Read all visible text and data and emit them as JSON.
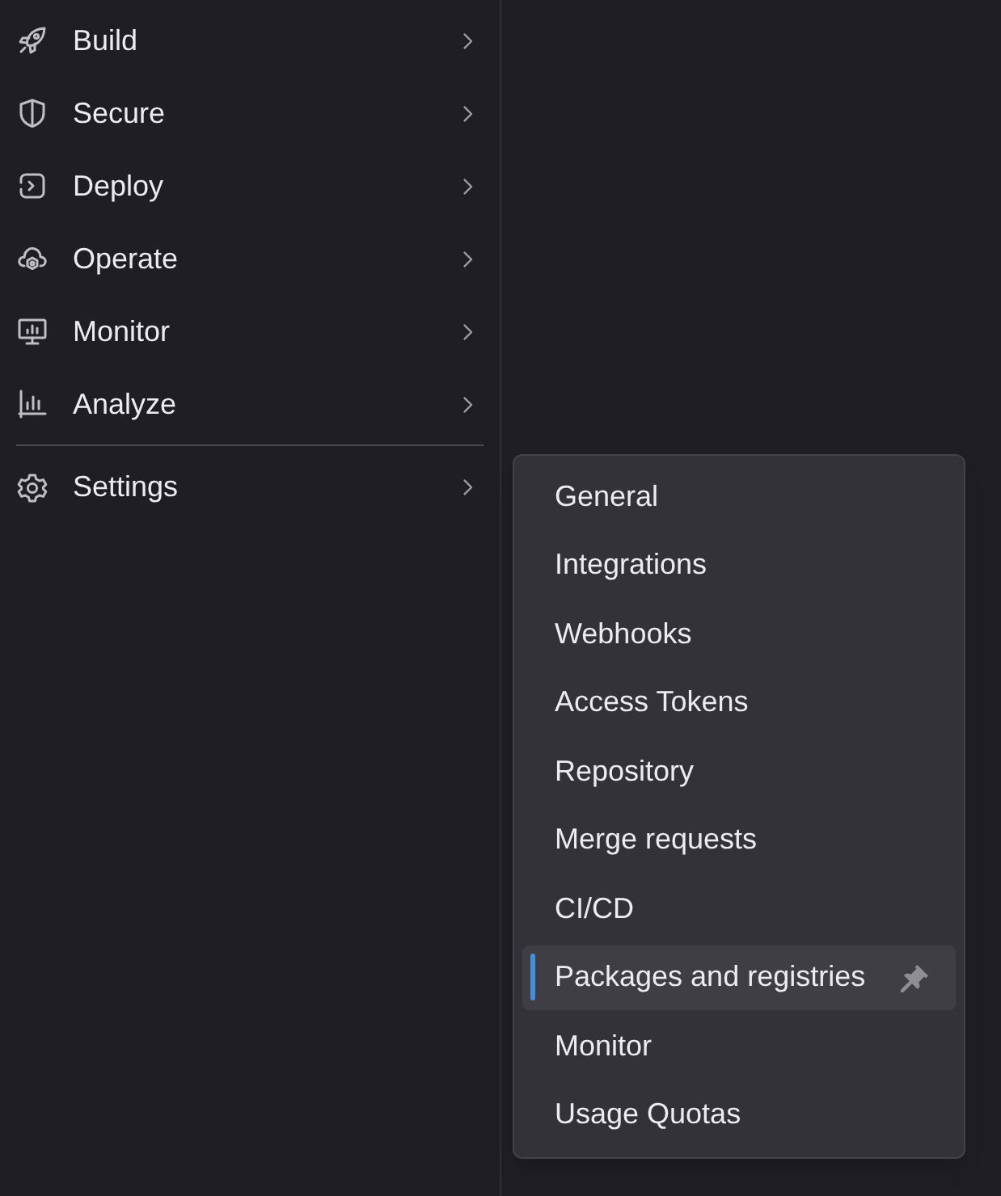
{
  "sidebar": {
    "groups": [
      {
        "items": [
          {
            "label": "Build"
          },
          {
            "label": "Secure"
          },
          {
            "label": "Deploy"
          },
          {
            "label": "Operate"
          },
          {
            "label": "Monitor"
          },
          {
            "label": "Analyze"
          }
        ]
      },
      {
        "items": [
          {
            "label": "Settings"
          }
        ]
      }
    ]
  },
  "flyout": {
    "items": [
      {
        "label": "General",
        "selected": false
      },
      {
        "label": "Integrations",
        "selected": false
      },
      {
        "label": "Webhooks",
        "selected": false
      },
      {
        "label": "Access Tokens",
        "selected": false
      },
      {
        "label": "Repository",
        "selected": false
      },
      {
        "label": "Merge requests",
        "selected": false
      },
      {
        "label": "CI/CD",
        "selected": false
      },
      {
        "label": "Packages and registries",
        "selected": true
      },
      {
        "label": "Monitor",
        "selected": false
      },
      {
        "label": "Usage Quotas",
        "selected": false
      }
    ]
  }
}
